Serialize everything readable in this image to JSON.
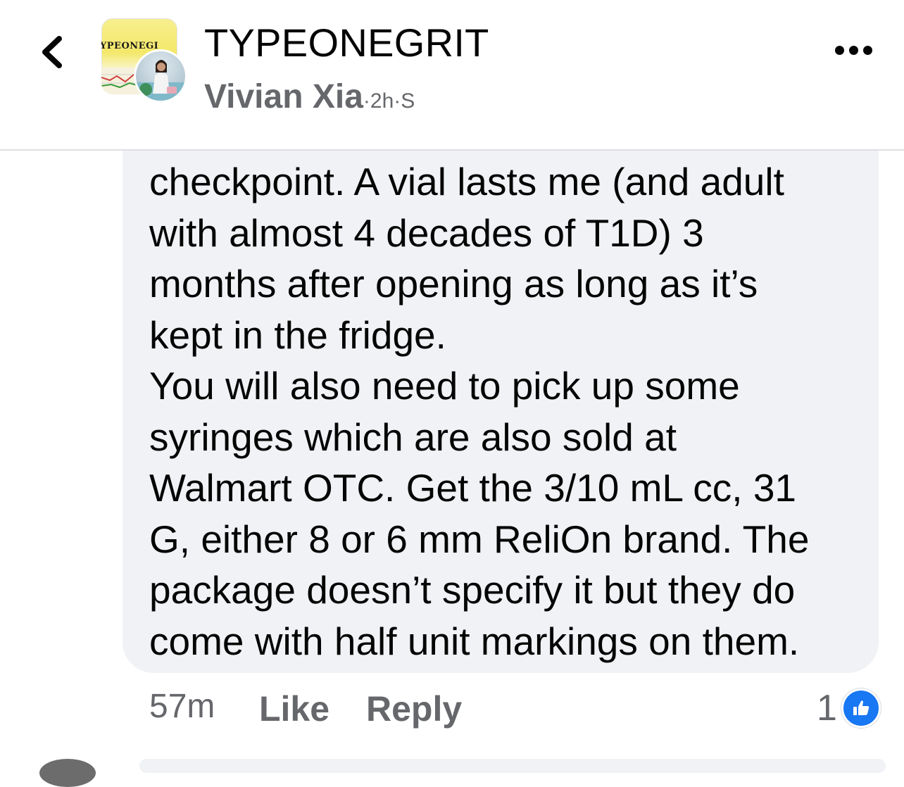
{
  "header": {
    "back_icon": "chevron-left-icon",
    "group_name": "TYPEONEGRIT",
    "group_avatar_text": "YPEONEGI",
    "author": "Vivian Xia",
    "separator": "·",
    "time": "2h",
    "extra": "S",
    "more_icon": "more-horizontal-icon"
  },
  "comment": {
    "text": "checkpoint. A vial lasts me (and adult\nwith almost 4 decades of T1D) 3\nmonths after opening as long as it’s\nkept in the fridge.\nYou will also need to pick up some\nsyringes which are also sold at\nWalmart OTC. Get the 3/10 mL cc, 31\nG, either 8 or 6 mm ReliOn brand. The\npackage doesn’t specify it but they do\ncome with half unit markings on them."
  },
  "actions": {
    "time": "57m",
    "like_label": "Like",
    "reply_label": "Reply",
    "reaction_count": "1",
    "reaction_icon": "thumbs-up-icon"
  },
  "colors": {
    "bubble_bg": "#f0f2f5",
    "secondary_text": "#65676b",
    "like_blue": "#1877f2"
  }
}
